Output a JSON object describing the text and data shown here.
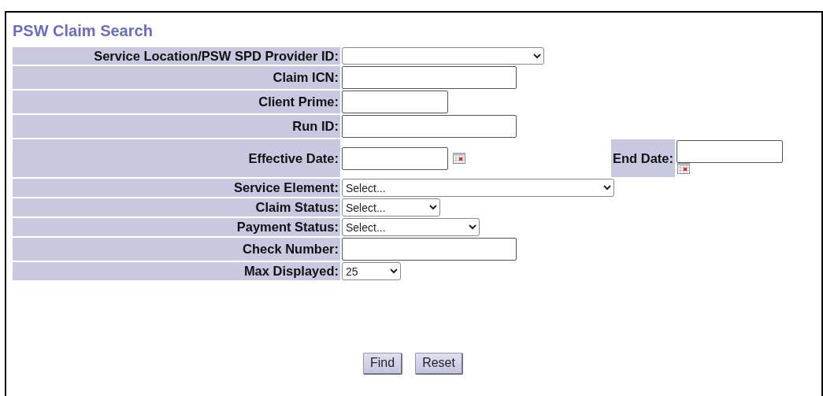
{
  "title": "PSW Claim Search",
  "fields": [
    {
      "kind": "select",
      "label": "Service Location/PSW SPD Provider ID:"
    },
    {
      "kind": "text",
      "label": "Claim ICN:"
    },
    {
      "kind": "text",
      "label": "Client Prime:"
    },
    {
      "kind": "text",
      "label": "Run ID:"
    },
    {
      "kind": "daterange",
      "label": "Effective Date:",
      "end_label": "End Date:"
    },
    {
      "kind": "select",
      "label": "Service Element:",
      "value": "Select..."
    },
    {
      "kind": "select",
      "label": "Claim Status:",
      "value": "Select..."
    },
    {
      "kind": "select",
      "label": "Payment Status:",
      "value": "Select..."
    },
    {
      "kind": "text",
      "label": "Check Number:"
    },
    {
      "kind": "select",
      "label": "Max Displayed:",
      "value": "25"
    }
  ],
  "buttons": [
    "Find",
    "Reset"
  ]
}
